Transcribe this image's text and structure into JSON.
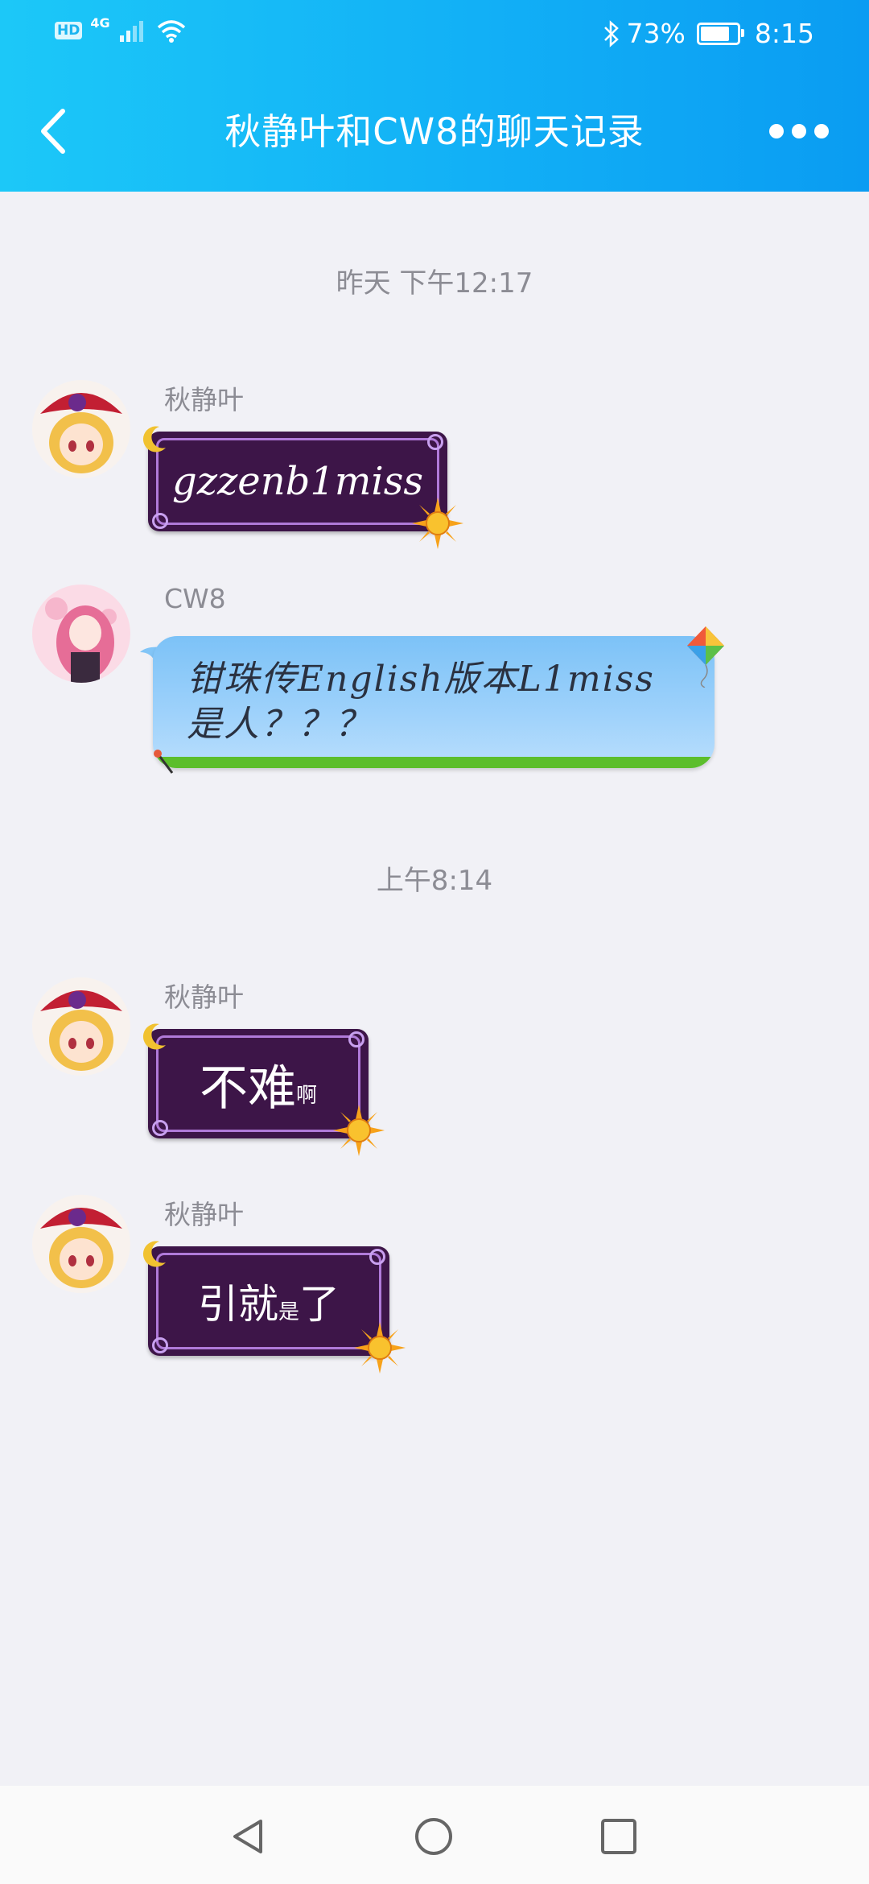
{
  "status_bar": {
    "hd": "HD",
    "network": "4G",
    "battery": "73%",
    "battery_level": 0.73,
    "time": "8:15"
  },
  "header": {
    "title": "秋静叶和CW8的聊天记录"
  },
  "messages": [
    {
      "type": "time",
      "text": "昨天 下午12:17"
    },
    {
      "type": "msg",
      "sender": "秋静叶",
      "text": "gzzenb1miss",
      "bubble": "purple"
    },
    {
      "type": "msg",
      "sender": "CW8",
      "text": "钳珠传English版本L1miss是人？？？",
      "bubble": "blue"
    },
    {
      "type": "time",
      "text": "上午8:14"
    },
    {
      "type": "msg",
      "sender": "秋静叶",
      "text_main": "不难",
      "text_small": "啊",
      "bubble": "purple"
    },
    {
      "type": "msg",
      "sender": "秋静叶",
      "text_a": "引就",
      "text_small": "是",
      "text_b": "了",
      "bubble": "purple"
    }
  ],
  "icons": {
    "back": "chevron-left-icon",
    "more": "more-dots-icon",
    "nav_back": "triangle-back-icon",
    "nav_home": "circle-home-icon",
    "nav_recents": "square-recents-icon"
  },
  "colors": {
    "header_start": "#1cc8f8",
    "header_end": "#0a9cf2",
    "purple_bubble": "#3d1548",
    "blue_bubble": "#9fd2fb",
    "background": "#f1f1f6"
  }
}
